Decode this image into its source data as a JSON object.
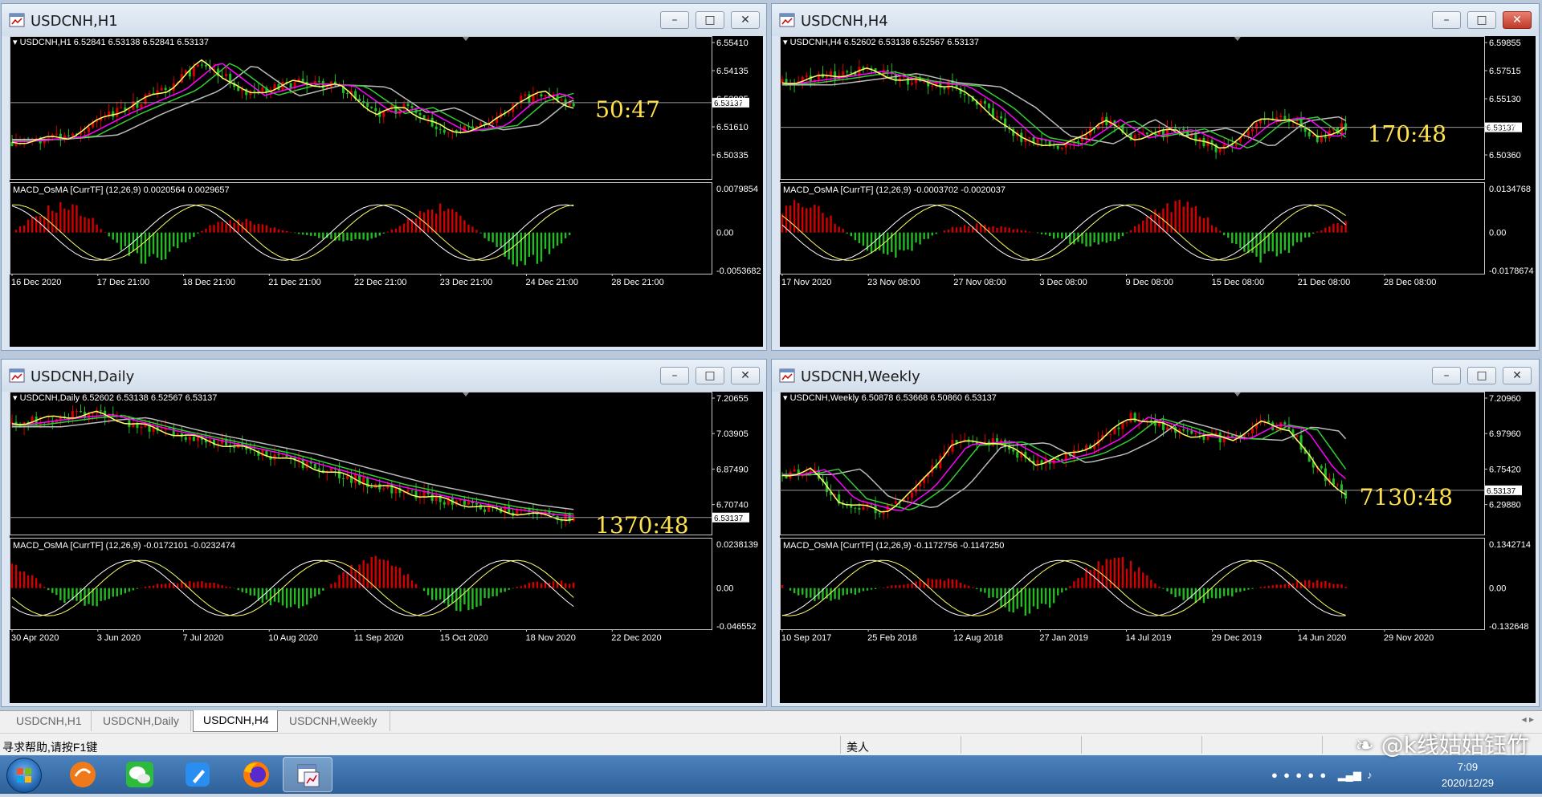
{
  "colors": {
    "bull": "#d40000",
    "bear": "#22bb22",
    "ema_fast": "#ffff66",
    "ema_slow": "#ff00ff",
    "ema_mid": "#33cc33",
    "ema_long": "#bbbbbb",
    "timer": "#ffe14d"
  },
  "windows": [
    {
      "title": "USDCNH,H1",
      "legend": "USDCNH,H1  6.52841 6.53138 6.52841 6.53137",
      "macd_legend": "MACD_OsMA [CurrTF] (12,26,9) 0.0020564 0.0029657",
      "price_ticks": [
        "6.55410",
        "6.54135",
        "6.52885",
        "6.51610",
        "6.50335"
      ],
      "current_price": "6.53137",
      "macd_ticks": [
        "0.0079854",
        "0.00",
        "-0.0053682"
      ],
      "time_labels": [
        "16 Dec 2020",
        "17 Dec 21:00",
        "18 Dec 21:00",
        "21 Dec 21:00",
        "22 Dec 21:00",
        "23 Dec 21:00",
        "24 Dec 21:00",
        "28 Dec 21:00"
      ],
      "timer": "50:47",
      "active": false
    },
    {
      "title": "USDCNH,H4",
      "legend": "USDCNH,H4  6.52602 6.53138 6.52567 6.53137",
      "macd_legend": "MACD_OsMA [CurrTF] (12,26,9) -0.0003702 -0.0020037",
      "price_ticks": [
        "6.59855",
        "6.57515",
        "6.55130",
        "6.52745",
        "6.50360"
      ],
      "current_price": "6.53137",
      "macd_ticks": [
        "0.0134768",
        "0.00",
        "-0.0178674"
      ],
      "time_labels": [
        "17 Nov 2020",
        "23 Nov 08:00",
        "27 Nov 08:00",
        "3 Dec 08:00",
        "9 Dec 08:00",
        "15 Dec 08:00",
        "21 Dec 08:00",
        "28 Dec 08:00"
      ],
      "timer": "170:48",
      "active": true
    },
    {
      "title": "USDCNH,Daily",
      "legend": "USDCNH,Daily  6.52602 6.53138 6.52567 6.53137",
      "macd_legend": "MACD_OsMA [CurrTF] (12,26,9) -0.0172101 -0.0232474",
      "price_ticks": [
        "7.20655",
        "7.03905",
        "6.87490",
        "6.70740"
      ],
      "current_price": "6.53137",
      "macd_ticks": [
        "0.0238139",
        "0.00",
        "-0.046552"
      ],
      "time_labels": [
        "30 Apr 2020",
        "3 Jun 2020",
        "7 Jul 2020",
        "10 Aug 2020",
        "11 Sep 2020",
        "15 Oct 2020",
        "18 Nov 2020",
        "22 Dec 2020"
      ],
      "timer": "1370:48",
      "active": false
    },
    {
      "title": "USDCNH,Weekly",
      "legend": "USDCNH,Weekly  6.50878 6.53668 6.50860 6.53137",
      "macd_legend": "MACD_OsMA [CurrTF] (12,26,9) -0.1172756 -0.1147250",
      "price_ticks": [
        "7.20960",
        "6.97960",
        "6.75420",
        "6.29880"
      ],
      "current_price": "6.53137",
      "macd_ticks": [
        "0.1342714",
        "0.00",
        "-0.132648"
      ],
      "time_labels": [
        "10 Sep 2017",
        "25 Feb 2018",
        "12 Aug 2018",
        "27 Jan 2019",
        "14 Jul 2019",
        "29 Dec 2019",
        "14 Jun 2020",
        "29 Nov 2020"
      ],
      "timer": "7130:48",
      "active": false
    }
  ],
  "tabs": [
    "USDCNH,H1",
    "USDCNH,Daily",
    "USDCNH,H4",
    "USDCNH,Weekly"
  ],
  "active_tab": "USDCNH,H4",
  "status": {
    "help": "寻求帮助,请按F1键",
    "profile": "美人"
  },
  "taskbar": {
    "time": "7:09",
    "date": "2020/12/29"
  },
  "watermark": "@k线姑姑钰竹"
}
